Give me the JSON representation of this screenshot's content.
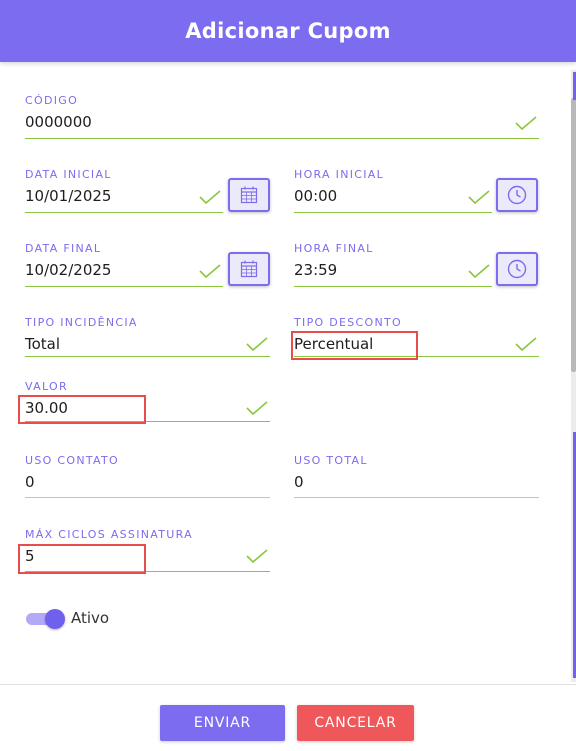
{
  "header": {
    "title": "Adicionar Cupom"
  },
  "colors": {
    "primary": "#7b6cf0",
    "valid": "#8cc63f",
    "warning": "#f0c24e",
    "highlight": "#e84d4d",
    "cancel": "#f0575a"
  },
  "fields": {
    "codigo": {
      "label": "CÓDIGO",
      "value": "0000000"
    },
    "data_inicial": {
      "label": "DATA INICIAL",
      "value": "10/01/2025"
    },
    "hora_inicial": {
      "label": "HORA INICIAL",
      "value": "00:00"
    },
    "data_final": {
      "label": "DATA FINAL",
      "value": "10/02/2025"
    },
    "hora_final": {
      "label": "HORA FINAL",
      "value": "23:59"
    },
    "tipo_incidencia": {
      "label": "TIPO INCIDÊNCIA",
      "value": "Total"
    },
    "tipo_desconto": {
      "label": "TIPO DESCONTO",
      "value": "Percentual"
    },
    "valor": {
      "label": "VALOR",
      "value": "30.00"
    },
    "uso_contato": {
      "label": "USO CONTATO",
      "value": "0"
    },
    "uso_total": {
      "label": "USO TOTAL",
      "value": "0"
    },
    "max_ciclos": {
      "label": "MÁX CICLOS ASSINATURA",
      "value": "5"
    }
  },
  "icons": {
    "calendar": "calendar-icon",
    "clock": "clock-icon",
    "check": "check-icon"
  },
  "toggle": {
    "label": "Ativo",
    "on": true
  },
  "buttons": {
    "submit": "ENVIAR",
    "cancel": "CANCELAR"
  }
}
